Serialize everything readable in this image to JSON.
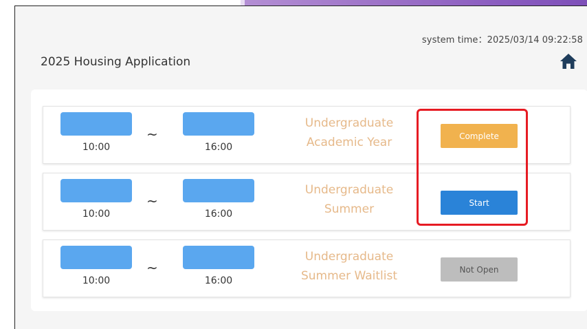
{
  "header": {
    "system_time_label": "system time",
    "system_time_separator": "：",
    "system_time_value": "2025/03/14 09:22:58",
    "title": "2025 Housing Application",
    "home_icon": "home-icon"
  },
  "applications": [
    {
      "start_time": "10:00",
      "separator": "~",
      "end_time": "16:00",
      "program_line1": "Undergraduate",
      "program_line2": "Academic Year",
      "status_label": "Complete"
    },
    {
      "start_time": "10:00",
      "separator": "~",
      "end_time": "16:00",
      "program_line1": "Undergraduate",
      "program_line2": "Summer",
      "status_label": "Start"
    },
    {
      "start_time": "10:00",
      "separator": "~",
      "end_time": "16:00",
      "program_line1": "Undergraduate",
      "program_line2": "Summer Waitlist",
      "status_label": "Not Open"
    }
  ],
  "colors": {
    "complete": "#f1b24e",
    "start": "#2a83d8",
    "not_open": "#bdbdbd",
    "program_text": "#e6b98a",
    "redaction": "#5aa7ef",
    "highlight": "#e61b23"
  }
}
